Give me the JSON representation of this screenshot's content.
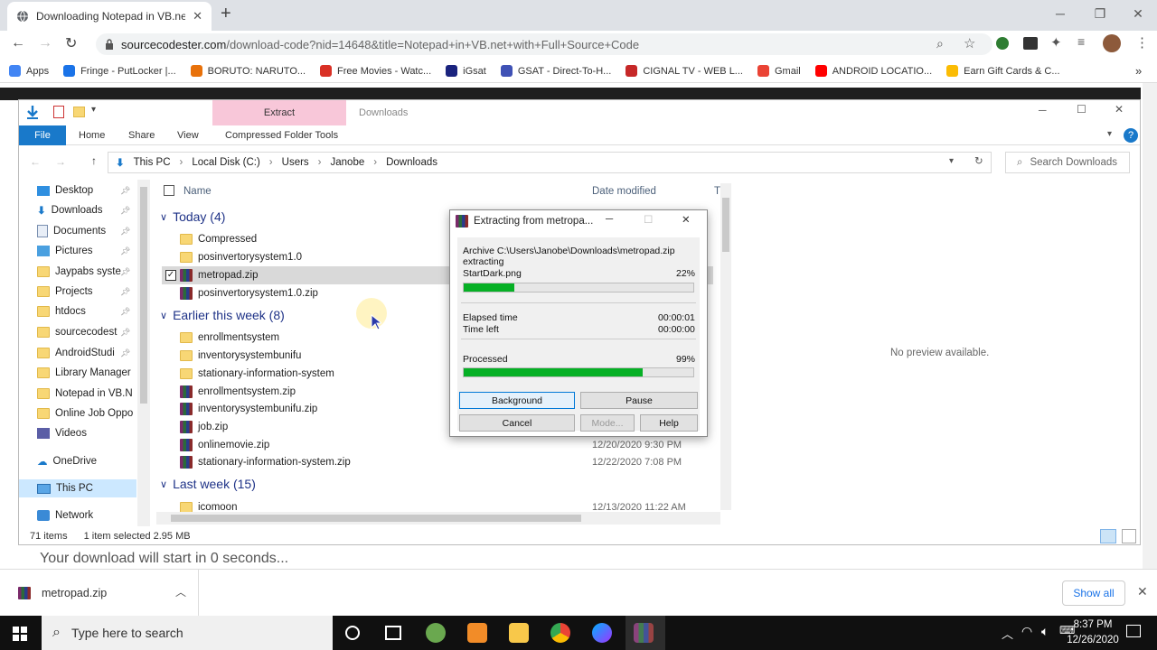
{
  "browser": {
    "tab_title": "Downloading Notepad in VB.net",
    "new_tab": "+",
    "url_host": "sourcecodester.com",
    "url_path": "/download-code?nid=14648&title=Notepad+in+VB.net+with+Full+Source+Code",
    "bookmarks": [
      {
        "label": "Apps",
        "color": "#4285f4"
      },
      {
        "label": "Fringe - PutLocker |...",
        "color": "#1a73e8"
      },
      {
        "label": "BORUTO: NARUTO...",
        "color": "#e8710a"
      },
      {
        "label": "Free Movies - Watc...",
        "color": "#d93025"
      },
      {
        "label": "iGsat",
        "color": "#1a237e"
      },
      {
        "label": "GSAT - Direct-To-H...",
        "color": "#3f51b5"
      },
      {
        "label": "CIGNAL TV - WEB L...",
        "color": "#c62828"
      },
      {
        "label": "Gmail",
        "color": "#ea4335"
      },
      {
        "label": "ANDROID LOCATIO...",
        "color": "#ff0000"
      },
      {
        "label": "Earn Gift Cards & C...",
        "color": "#fbbc04"
      }
    ]
  },
  "explorer": {
    "ribbon": {
      "extract_tab": "Extract",
      "downloads_title": "Downloads",
      "tabs": [
        "File",
        "Home",
        "Share",
        "View",
        "Compressed Folder Tools"
      ]
    },
    "breadcrumb": [
      "This PC",
      "Local Disk (C:)",
      "Users",
      "Janobe",
      "Downloads"
    ],
    "search_placeholder": "Search Downloads",
    "nav": [
      {
        "label": "Desktop",
        "pin": true
      },
      {
        "label": "Downloads",
        "pin": true
      },
      {
        "label": "Documents",
        "pin": true
      },
      {
        "label": "Pictures",
        "pin": true
      },
      {
        "label": "Jaypabs syste",
        "pin": true
      },
      {
        "label": "Projects",
        "pin": true
      },
      {
        "label": "htdocs",
        "pin": true
      },
      {
        "label": "sourcecodest",
        "pin": true
      },
      {
        "label": "AndroidStudi",
        "pin": true
      },
      {
        "label": "Library Manager",
        "pin": false
      },
      {
        "label": "Notepad in VB.N",
        "pin": false
      },
      {
        "label": "Online Job Oppo",
        "pin": false
      },
      {
        "label": "Videos",
        "pin": false
      },
      {
        "label": "OneDrive",
        "pin": false
      },
      {
        "label": "This PC",
        "pin": false
      },
      {
        "label": "Network",
        "pin": false
      }
    ],
    "columns": {
      "name": "Name",
      "date": "Date modified",
      "type": "T"
    },
    "groups": [
      {
        "label": "Today (4)"
      },
      {
        "label": "Earlier this week (8)"
      },
      {
        "label": "Last week (15)"
      }
    ],
    "files": [
      {
        "name": "Compressed",
        "kind": "folder",
        "date": ""
      },
      {
        "name": "posinvertorysystem1.0",
        "kind": "folder",
        "date": ""
      },
      {
        "name": "metropad.zip",
        "kind": "zip",
        "date": ""
      },
      {
        "name": "posinvertorysystem1.0.zip",
        "kind": "zip",
        "date": ""
      },
      {
        "name": "enrollmentsystem",
        "kind": "folder",
        "date": ""
      },
      {
        "name": "inventorysystembunifu",
        "kind": "folder",
        "date": ""
      },
      {
        "name": "stationary-information-system",
        "kind": "folder",
        "date": ""
      },
      {
        "name": "enrollmentsystem.zip",
        "kind": "zip",
        "date": ""
      },
      {
        "name": "inventorysystembunifu.zip",
        "kind": "zip",
        "date": ""
      },
      {
        "name": "job.zip",
        "kind": "zip",
        "date": ""
      },
      {
        "name": "onlinemovie.zip",
        "kind": "zip",
        "date": "12/20/2020 9:30 PM"
      },
      {
        "name": "stationary-information-system.zip",
        "kind": "zip",
        "date": "12/22/2020 7:08 PM"
      },
      {
        "name": "icomoon",
        "kind": "folder",
        "date": "12/13/2020 11:22 AM"
      }
    ],
    "status": {
      "items": "71 items",
      "selected": "1 item selected  2.95 MB"
    },
    "preview": "No preview available."
  },
  "dialog": {
    "title": "Extracting from metropa...",
    "archive_line": "Archive C:\\Users\\Janobe\\Downloads\\metropad.zip",
    "action": "extracting",
    "current_file": "StartDark.png",
    "file_percent_label": "22%",
    "file_progress": 0.22,
    "elapsed_label": "Elapsed time",
    "elapsed_value": "00:00:01",
    "timeleft_label": "Time left",
    "timeleft_value": "00:00:00",
    "processed_label": "Processed",
    "processed_percent_label": "99%",
    "processed_progress": 0.78,
    "buttons": {
      "background": "Background",
      "pause": "Pause",
      "cancel": "Cancel",
      "mode": "Mode...",
      "help": "Help"
    }
  },
  "page": {
    "download_text": "Your download will start in 0 seconds..."
  },
  "shelf": {
    "file": "metropad.zip",
    "show_all": "Show all"
  },
  "taskbar": {
    "search": "Type here to search",
    "time": "8:37 PM",
    "date": "12/26/2020"
  }
}
